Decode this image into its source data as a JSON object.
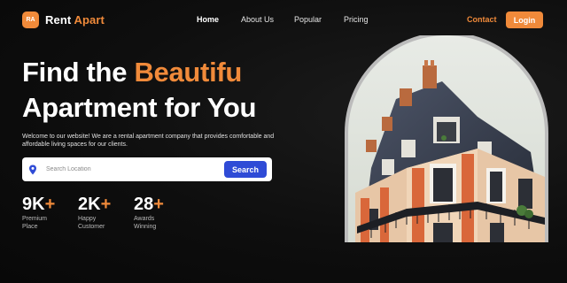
{
  "brand": {
    "badge": "RA",
    "name_part1": "Rent",
    "name_part2": "Apart"
  },
  "nav": {
    "home": "Home",
    "about": "About Us",
    "popular": "Popular",
    "pricing": "Pricing",
    "contact": "Contact",
    "login": "Login"
  },
  "hero": {
    "line1_plain": "Find the ",
    "line1_accent": "Beautifu",
    "line2": "Apartment for You",
    "description": "Welcome to our website! We are a rental apartment company that provides comfortable and affordable living spaces for our clients."
  },
  "search": {
    "placeholder": "Search Location",
    "value": "",
    "button": "Search",
    "icon": "location-pin-icon"
  },
  "stats": [
    {
      "number": "9K",
      "plus": "+",
      "line1": "Premium",
      "line2": "Place"
    },
    {
      "number": "2K",
      "plus": "+",
      "line1": "Happy",
      "line2": "Customer"
    },
    {
      "number": "28",
      "plus": "+",
      "line1": "Awards",
      "line2": "Winning"
    }
  ],
  "colors": {
    "accent": "#f08a3a",
    "search_button": "#2f4bd6",
    "background": "#0e0e0e"
  },
  "image": {
    "subject": "apartment-building-photo"
  }
}
